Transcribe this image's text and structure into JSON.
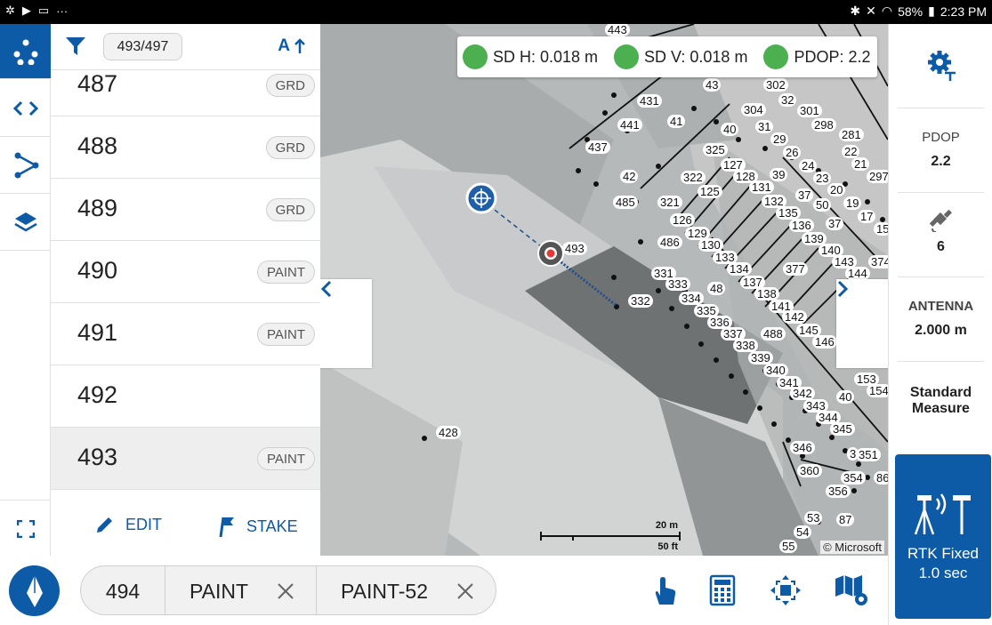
{
  "status_bar": {
    "battery": "58%",
    "time": "2:23 PM",
    "left_icons": [
      "fan-icon",
      "play-flag-icon",
      "screen-icon",
      "more-icon"
    ],
    "right_icons": [
      "bluetooth-icon",
      "mute-icon",
      "wifi-icon",
      "battery-icon"
    ]
  },
  "colors": {
    "accent": "#0d5aa7",
    "ok_green": "#4caf50",
    "target_red": "#e53935"
  },
  "panel": {
    "count": "493/497",
    "sort_label": "A",
    "points": [
      {
        "number": "487",
        "code": "GRD",
        "selected": false
      },
      {
        "number": "488",
        "code": "GRD",
        "selected": false
      },
      {
        "number": "489",
        "code": "GRD",
        "selected": false
      },
      {
        "number": "490",
        "code": "PAINT",
        "selected": false
      },
      {
        "number": "491",
        "code": "PAINT",
        "selected": false
      },
      {
        "number": "492",
        "code": "",
        "selected": false
      },
      {
        "number": "493",
        "code": "PAINT",
        "selected": true
      }
    ],
    "edit_label": "EDIT",
    "stake_label": "STAKE"
  },
  "map": {
    "quality": [
      {
        "label": "SD H: 0.018 m"
      },
      {
        "label": "SD V: 0.018 m"
      },
      {
        "label": "PDOP: 2.2"
      }
    ],
    "scale_m": "20 m",
    "scale_ft": "50 ft",
    "attribution": "© Microsoft",
    "point_labels": [
      "443",
      "431",
      "43",
      "302",
      "441",
      "41",
      "304",
      "32",
      "301",
      "437",
      "40",
      "31",
      "29",
      "298",
      "281",
      "325",
      "127",
      "26",
      "24",
      "22",
      "21",
      "42",
      "322",
      "128",
      "39",
      "23",
      "297",
      "321",
      "125",
      "131",
      "132",
      "37",
      "50",
      "20",
      "19",
      "485",
      "126",
      "135",
      "136",
      "37",
      "17",
      "15",
      "129",
      "486",
      "139",
      "140",
      "143",
      "374",
      "130",
      "133",
      "493",
      "377",
      "331",
      "134",
      "144",
      "333",
      "48",
      "137",
      "138",
      "332",
      "334",
      "141",
      "335",
      "142",
      "336",
      "145",
      "488",
      "337",
      "146",
      "338",
      "339",
      "340",
      "341",
      "153",
      "154",
      "342",
      "40",
      "343",
      "344",
      "428",
      "345",
      "346",
      "3",
      "351",
      "360",
      "354",
      "356",
      "86",
      "53",
      "87",
      "54",
      "55"
    ]
  },
  "right": {
    "pdop_label": "PDOP",
    "pdop_value": "2.2",
    "sats_value": "6",
    "antenna_label": "ANTENNA",
    "antenna_value": "2.000 m",
    "method_line1": "Standard",
    "method_line2": "Measure",
    "rtk_line1": "RTK Fixed",
    "rtk_line2": "1.0 sec"
  },
  "bottom": {
    "next_point": "494",
    "code": "PAINT",
    "description": "PAINT-52"
  }
}
